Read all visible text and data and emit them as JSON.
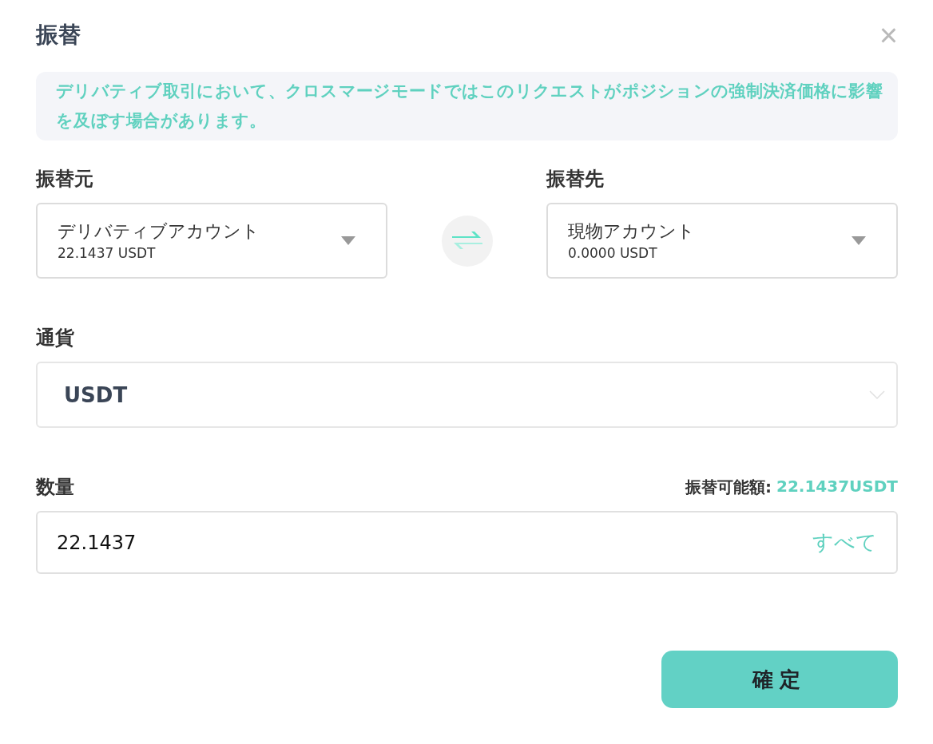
{
  "dialog": {
    "title": "振替",
    "close": "×"
  },
  "notice": "デリバティブ取引において、クロスマージモードではこのリクエストがポジションの強制決済価格に影響を及ぼす場合があります。",
  "from": {
    "label": "振替元",
    "account": "デリバティブアカウント",
    "balance": "22.1437 USDT"
  },
  "to": {
    "label": "振替先",
    "account": "現物アカウント",
    "balance": "0.0000 USDT"
  },
  "currency": {
    "label": "通貨",
    "value": "USDT"
  },
  "amount": {
    "label": "数量",
    "available_label": "振替可能額:",
    "available_value": "22.1437USDT",
    "value": "22.1437",
    "all_button": "すべて"
  },
  "confirm_button": "確定"
}
